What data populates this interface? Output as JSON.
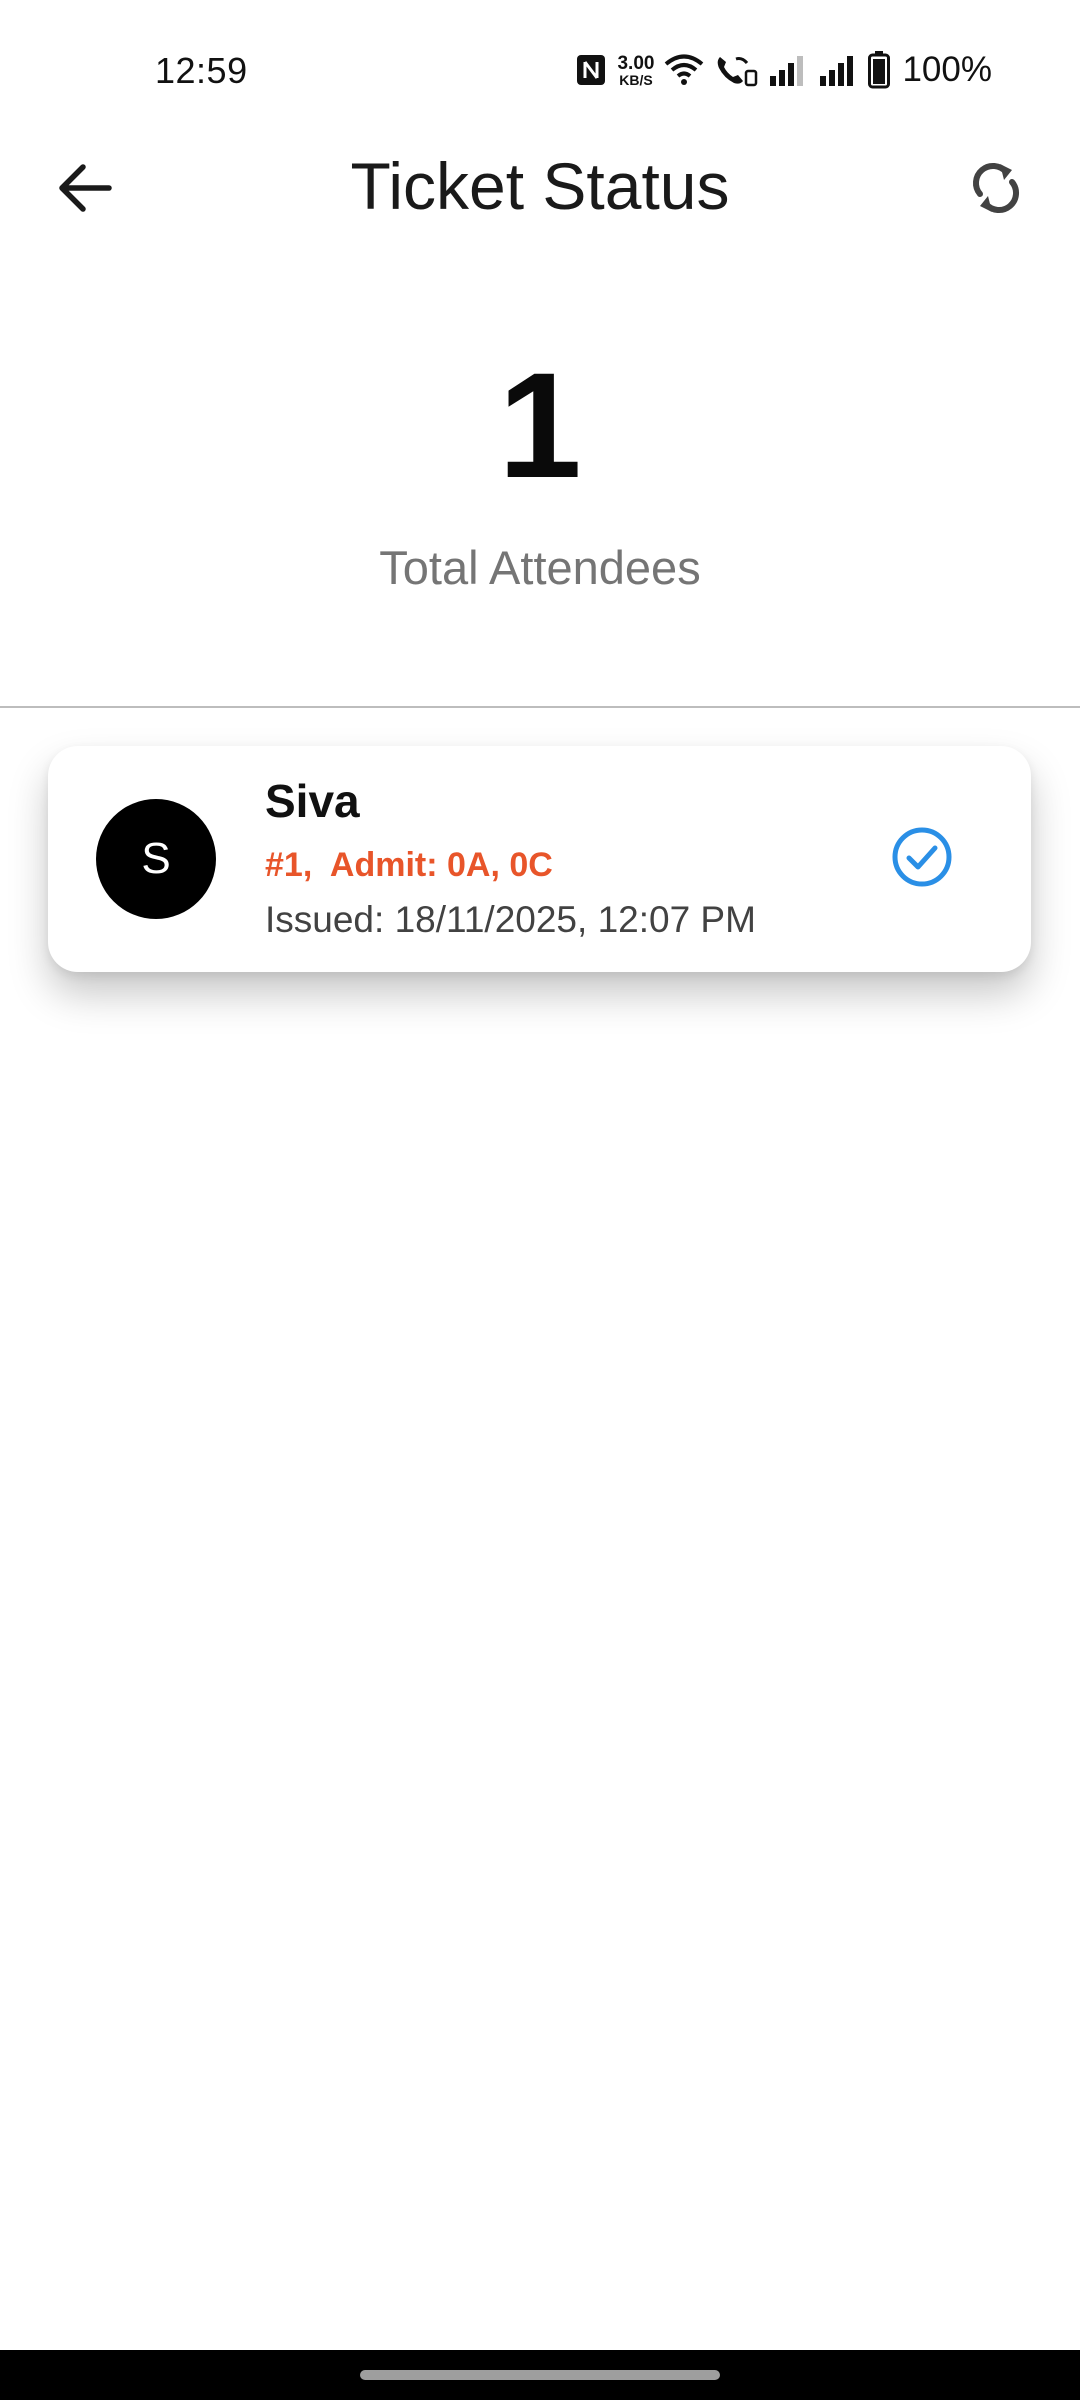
{
  "status_bar": {
    "time": "12:59",
    "speed_value": "3.00",
    "speed_unit": "KB/S",
    "battery": "100%",
    "icons": [
      "nfc-icon",
      "wifi-icon",
      "call-icon",
      "signal-icon",
      "signal-icon",
      "battery-icon"
    ]
  },
  "app_bar": {
    "title": "Ticket Status",
    "back_icon": "arrow-left-icon",
    "refresh_icon": "refresh-icon"
  },
  "summary": {
    "total_count": "1",
    "total_label": "Total Attendees"
  },
  "attendees": [
    {
      "avatar_initial": "S",
      "name": "Siva",
      "ticket_info": "#1,  Admit: 0A, 0C",
      "issued": "Issued: 18/11/2025, 12:07 PM",
      "status_icon": "check-circle-icon"
    }
  ],
  "colors": {
    "accent_orange": "#e8552a",
    "check_blue": "#2a8fe6",
    "avatar_bg": "#000000",
    "label_gray": "#757575"
  }
}
